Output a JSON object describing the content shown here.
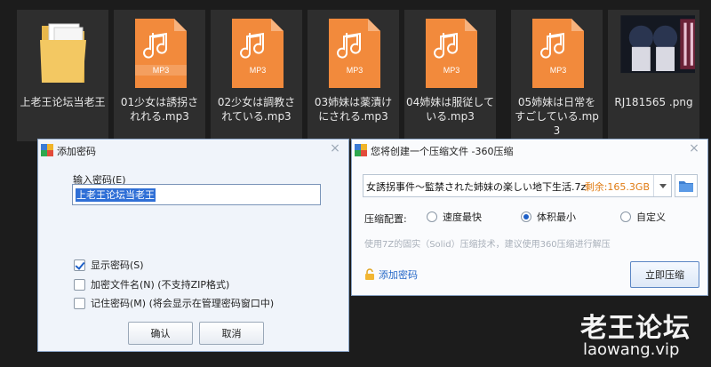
{
  "explorer": {
    "files": [
      {
        "name": "上老王论坛当老王",
        "icon": "folder-icon"
      },
      {
        "name": "01少女は誘拐されれる.mp3",
        "icon": "mp3-file-icon",
        "badge": "MP3"
      },
      {
        "name": "02少女は調教されている.mp3",
        "icon": "mp3-file-icon",
        "badge": "MP3"
      },
      {
        "name": "03姉妹は薬漬けにされる.mp3",
        "icon": "mp3-file-icon",
        "badge": "MP3"
      },
      {
        "name": "04姉妹は服従している.mp3",
        "icon": "mp3-file-icon",
        "badge": "MP3"
      },
      {
        "name": "05姉妹は日常をすごしている.mp3",
        "icon": "mp3-file-icon",
        "badge": "MP3"
      },
      {
        "name": "RJ181565 .png",
        "icon": "image-thumbnail"
      }
    ]
  },
  "password_dialog": {
    "title": "添加密码",
    "input_label": "输入密码(E)",
    "input_value": "上老王论坛当老王",
    "options": [
      {
        "label": "显示密码(S)",
        "checked": true
      },
      {
        "label": "加密文件名(N) (不支持ZIP格式)",
        "checked": false
      },
      {
        "label": "记住密码(M) (将会显示在管理密码窗口中)",
        "checked": false
      }
    ],
    "ok_label": "确认",
    "cancel_label": "取消",
    "close_icon": "×"
  },
  "compress_dialog": {
    "title": "您将创建一个压缩文件 -360压缩",
    "path_value": "女誘拐事件～監禁された姉妹の楽しい地下生活.7z",
    "free_space": "剩余:165.3GB",
    "options_label": "压缩配置:",
    "radio_options": [
      {
        "label": "速度最快",
        "selected": false
      },
      {
        "label": "体积最小",
        "selected": true
      },
      {
        "label": "自定义",
        "selected": false
      }
    ],
    "hint": "使用7Z的固实（Solid）压缩技术，建议使用360压缩进行解压",
    "add_password_label": "添加密码",
    "compress_button_label": "立即压缩",
    "close_icon": "×",
    "accent_color": "#2467c7",
    "free_space_color": "#e07c14"
  },
  "watermark": {
    "title": "老王论坛",
    "url": "laowang.vip"
  }
}
